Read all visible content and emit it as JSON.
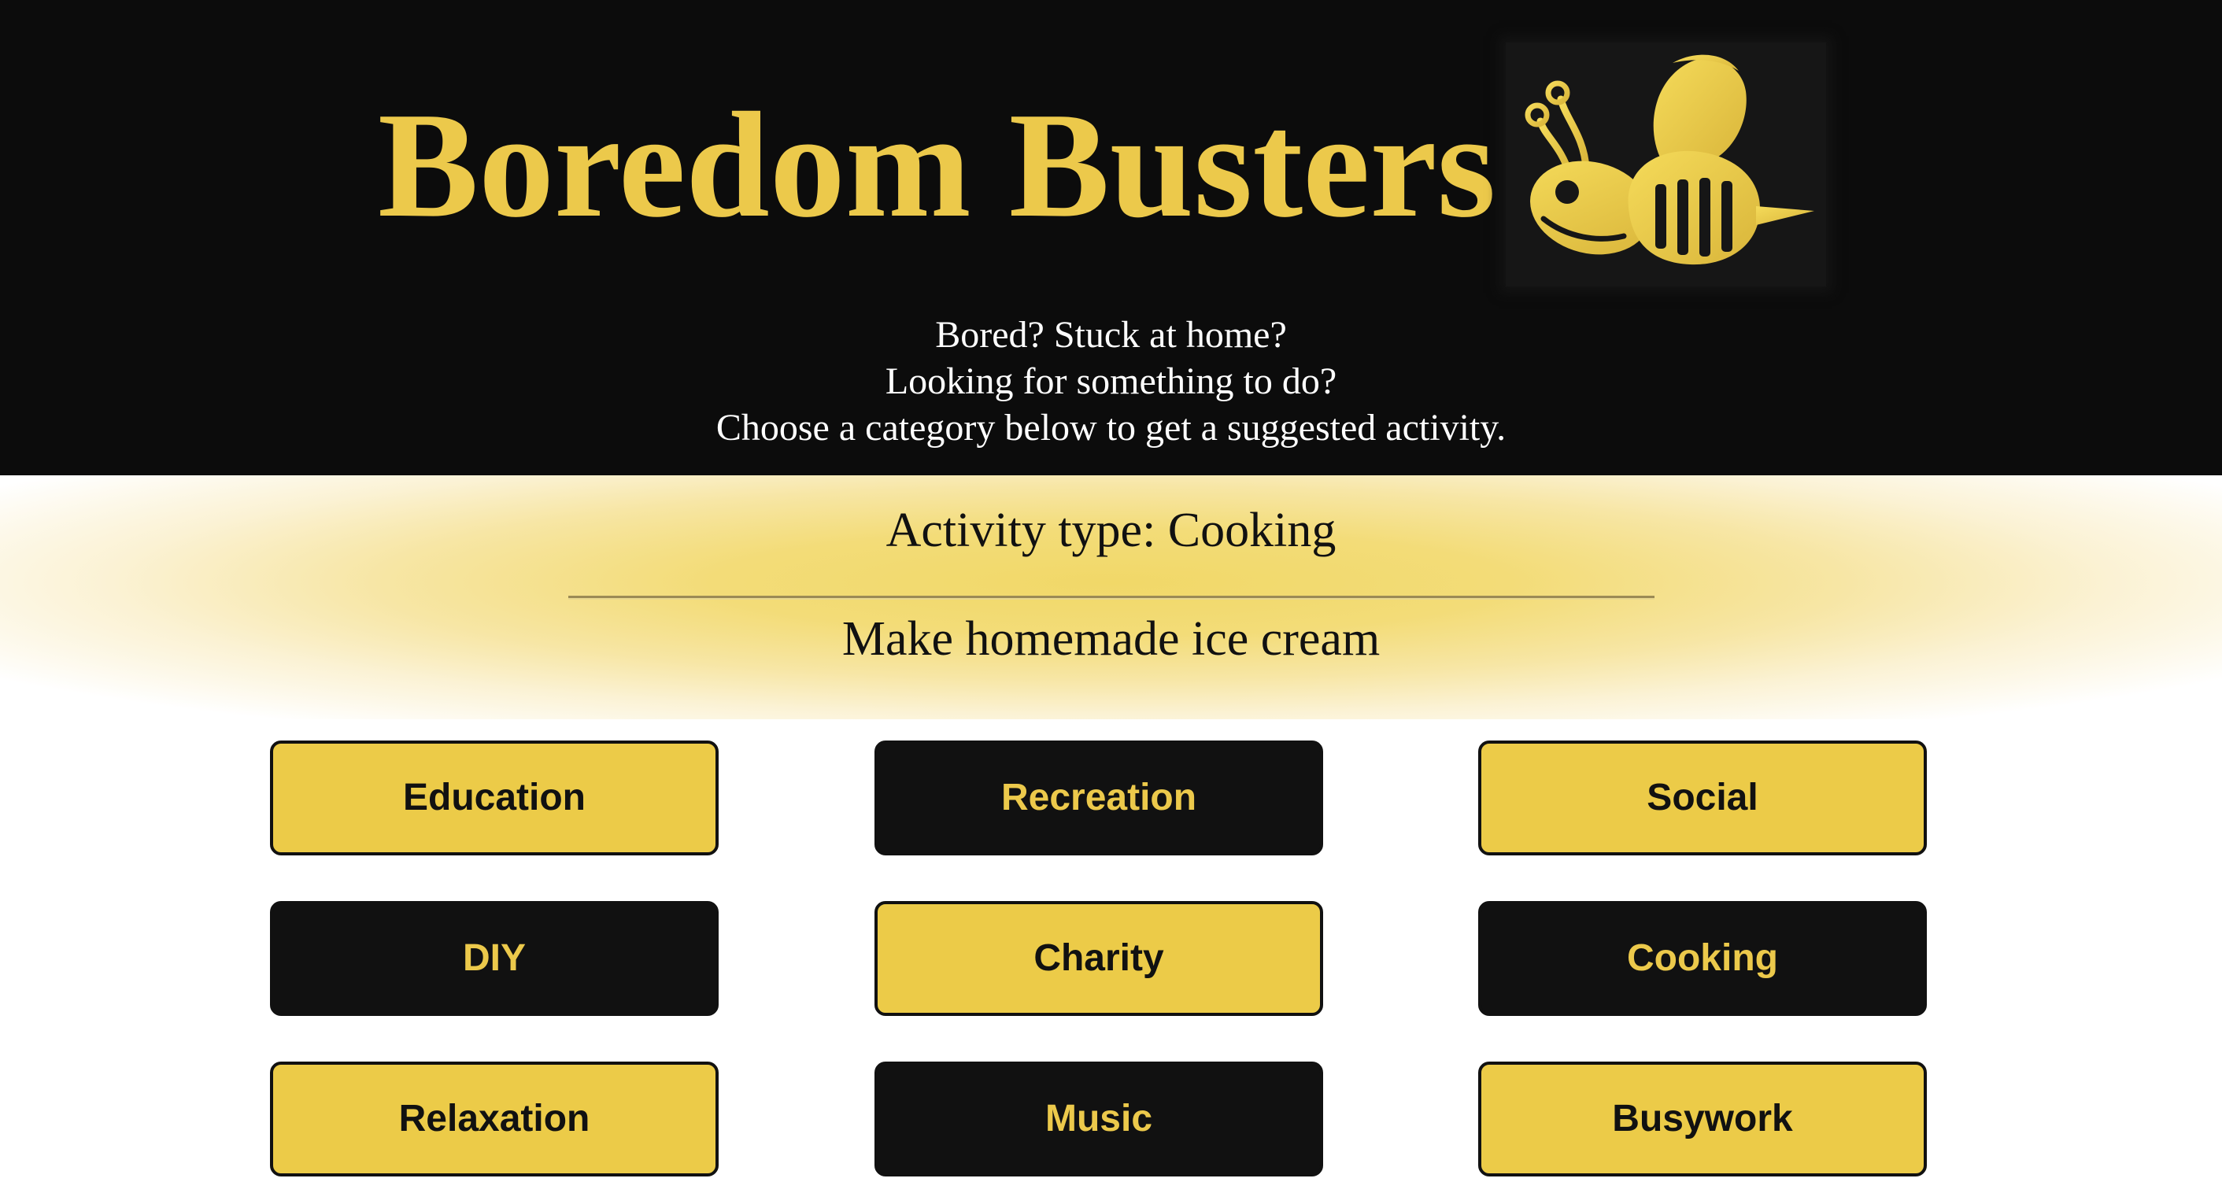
{
  "header": {
    "title": "Boredom Busters",
    "logo_icon": "bee-icon",
    "subtitle_lines": [
      "Bored? Stuck at home?",
      "Looking for something to do?",
      "Choose a category below to get a suggested activity."
    ]
  },
  "result": {
    "activity_type": "Activity type: Cooking",
    "activity": "Make homemade ice cream"
  },
  "categories": [
    {
      "label": "Education",
      "style": "yellow"
    },
    {
      "label": "Recreation",
      "style": "dark"
    },
    {
      "label": "Social",
      "style": "yellow"
    },
    {
      "label": "DIY",
      "style": "dark"
    },
    {
      "label": "Charity",
      "style": "yellow"
    },
    {
      "label": "Cooking",
      "style": "dark"
    },
    {
      "label": "Relaxation",
      "style": "yellow"
    },
    {
      "label": "Music",
      "style": "dark"
    },
    {
      "label": "Busywork",
      "style": "yellow"
    }
  ],
  "colors": {
    "header_bg": "#0c0c0c",
    "accent_yellow": "#ecc94b",
    "button_dark": "#111111",
    "text_dark": "#111111",
    "text_light": "#ffffff"
  }
}
